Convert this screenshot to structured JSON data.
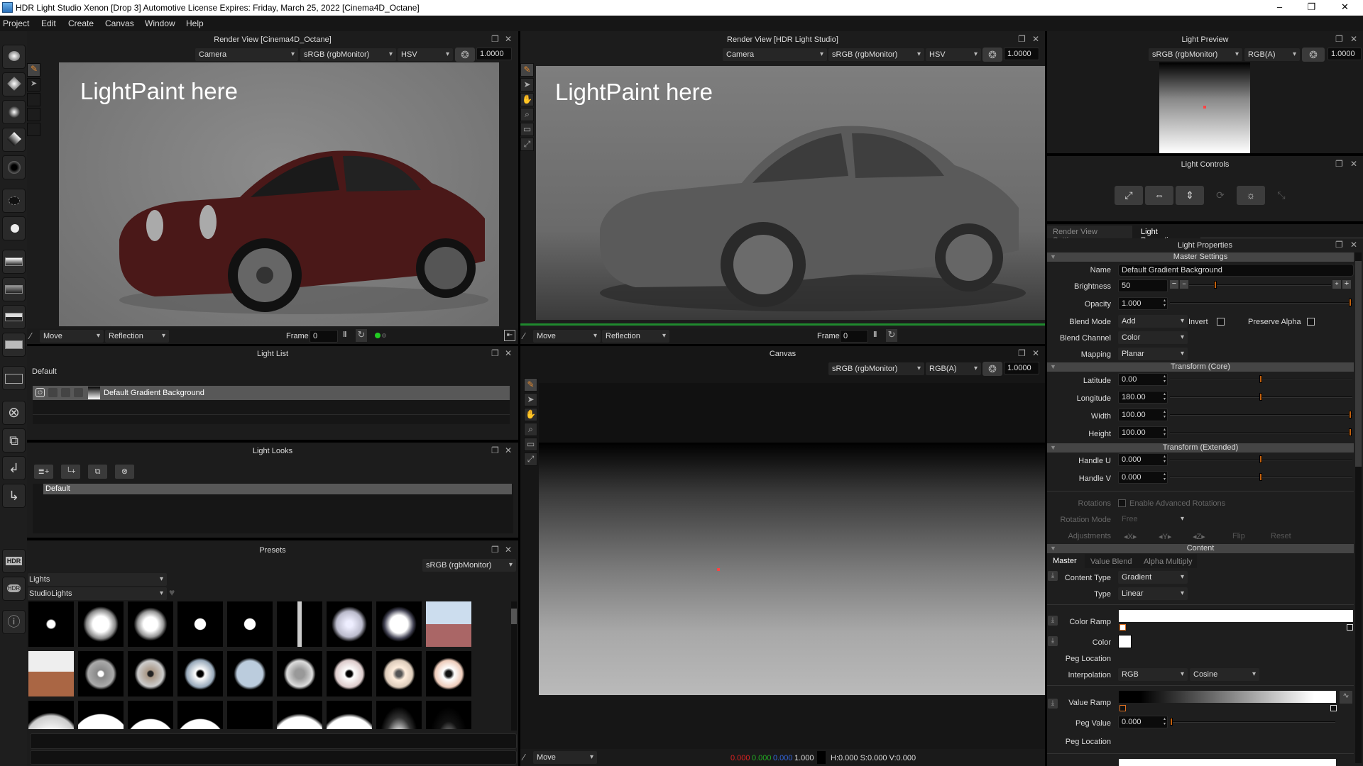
{
  "window": {
    "title": "HDR Light Studio Xenon [Drop 3] Automotive License Expires: Friday, March 25, 2022  [Cinema4D_Octane]",
    "minimize": "–",
    "maximize": "❐",
    "close": "✕"
  },
  "menu": [
    "Project",
    "Edit",
    "Create",
    "Canvas",
    "Window",
    "Help"
  ],
  "render_view_c4d": {
    "title": "Render View [Cinema4D_Octane]",
    "camera": "Camera",
    "colorspace": "sRGB (rgbMonitor)",
    "mode": "HSV",
    "exposure": "1.0000",
    "overlay_text": "LightPaint here",
    "tool": "Move",
    "paint_mode": "Reflection",
    "frame_label": "Frame",
    "frame_value": "0",
    "status_color": "#22cc22"
  },
  "render_view_hdr": {
    "title": "Render View [HDR Light Studio]",
    "camera": "Camera",
    "colorspace": "sRGB (rgbMonitor)",
    "mode": "HSV",
    "exposure": "1.0000",
    "overlay_text": "LightPaint here",
    "tool": "Move",
    "paint_mode": "Reflection",
    "frame_label": "Frame",
    "frame_value": "0"
  },
  "light_preview": {
    "title": "Light Preview",
    "colorspace": "sRGB (rgbMonitor)",
    "mode": "RGB(A)",
    "exposure": "1.0000"
  },
  "light_controls": {
    "title": "Light Controls",
    "buttons": [
      "scale",
      "width",
      "height",
      "rotate",
      "brightness",
      "stretch"
    ]
  },
  "tabs": {
    "render_view_settings": "Render View Settings",
    "light_properties": "Light Properties"
  },
  "light_list": {
    "title": "Light List",
    "group": "Default",
    "items": [
      {
        "name": "Default Gradient Background"
      }
    ]
  },
  "light_looks": {
    "title": "Light Looks",
    "items": [
      "Default"
    ]
  },
  "presets": {
    "title": "Presets",
    "colorspace": "sRGB (rgbMonitor)",
    "category": "Lights",
    "subcategory": "StudioLights",
    "count_rows": 3,
    "count_cols": 9
  },
  "canvas": {
    "title": "Canvas",
    "colorspace": "sRGB (rgbMonitor)",
    "mode": "RGB(A)",
    "exposure": "1.0000",
    "tool": "Move",
    "r": "0.000",
    "g": "0.000",
    "b": "0.000",
    "a": "1.000",
    "hsv": "H:0.000 S:0.000 V:0.000"
  },
  "properties": {
    "title": "Light Properties",
    "master_settings": "Master Settings",
    "name_label": "Name",
    "name_value": "Default Gradient Background",
    "brightness_label": "Brightness",
    "brightness_value": "50",
    "brightness_fraction": 0.18,
    "opacity_label": "Opacity",
    "opacity_value": "1.000",
    "opacity_fraction": 1.0,
    "blend_mode_label": "Blend Mode",
    "blend_mode_value": "Add",
    "invert_label": "Invert",
    "preserve_alpha_label": "Preserve Alpha",
    "blend_channel_label": "Blend Channel",
    "blend_channel_value": "Color",
    "mapping_label": "Mapping",
    "mapping_value": "Planar",
    "transform_core": "Transform (Core)",
    "latitude_label": "Latitude",
    "latitude_value": "0.00",
    "latitude_fraction": 0.5,
    "longitude_label": "Longitude",
    "longitude_value": "180.00",
    "longitude_fraction": 0.5,
    "width_label": "Width",
    "width_value": "100.00",
    "width_fraction": 1.0,
    "height_label": "Height",
    "height_value": "100.00",
    "height_fraction": 1.0,
    "transform_extended": "Transform (Extended)",
    "handle_u_label": "Handle U",
    "handle_u_value": "0.000",
    "handle_u_fraction": 0.5,
    "handle_v_label": "Handle V",
    "handle_v_value": "0.000",
    "handle_v_fraction": 0.5,
    "rotations_label": "Rotations",
    "enable_adv_rot": "Enable Advanced Rotations",
    "rotation_mode_label": "Rotation Mode",
    "rotation_mode_value": "Free",
    "adjustments_label": "Adjustments",
    "adj_x": "X",
    "adj_y": "Y",
    "adj_z": "Z",
    "flip": "Flip",
    "reset": "Reset",
    "content": "Content",
    "content_tabs": [
      "Master",
      "Value Blend",
      "Alpha Multiply"
    ],
    "content_type_label": "Content Type",
    "content_type_value": "Gradient",
    "type_label": "Type",
    "type_value": "Linear",
    "color_ramp_label": "Color Ramp",
    "color_label": "Color",
    "color_value": "#ffffff",
    "peg_location_label": "Peg Location",
    "interpolation_label": "Interpolation",
    "interpolation_value": "RGB",
    "interpolation_curve": "Cosine",
    "value_ramp_label": "Value Ramp",
    "peg_value_label": "Peg Value",
    "peg_value_value": "0.000",
    "peg_value_fraction": 0.0,
    "peg_location2_label": "Peg Location"
  },
  "left_toolbar": {
    "hdr_label": "HDR"
  },
  "colors": {
    "accent": "#c4610d",
    "red": "#dd2222",
    "green": "#22aa22",
    "blue": "#3366dd"
  }
}
